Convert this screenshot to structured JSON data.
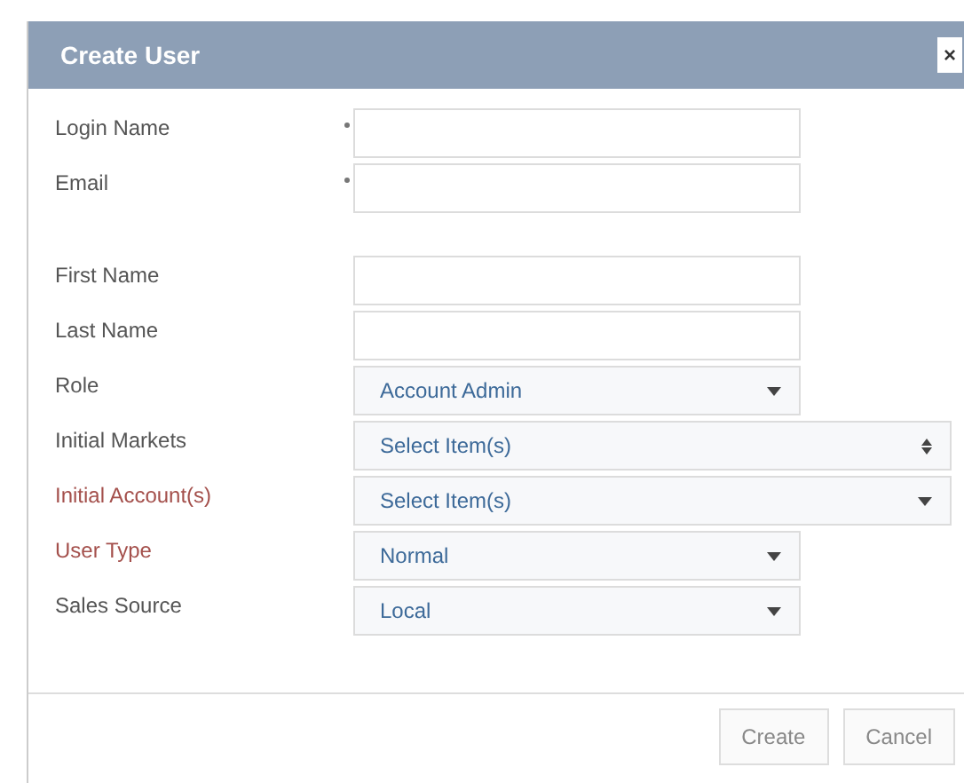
{
  "dialog": {
    "title": "Create User",
    "close": "×"
  },
  "sections": [
    [
      {
        "label": "Login Name",
        "kind": "text",
        "required": true,
        "error": false
      },
      {
        "label": "Email",
        "kind": "text",
        "required": true,
        "error": false
      }
    ],
    [
      {
        "label": "First Name",
        "kind": "text",
        "required": false,
        "error": false
      },
      {
        "label": "Last Name",
        "kind": "text",
        "required": false,
        "error": false
      },
      {
        "label": "Role",
        "kind": "select",
        "value": "Account Admin",
        "required": false,
        "error": false
      },
      {
        "label": "Initial Markets",
        "kind": "multiselect",
        "value": "Select Item(s)",
        "required": false,
        "error": false
      },
      {
        "label": "Initial Account(s)",
        "kind": "lookup",
        "value": "Select Item(s)",
        "required": false,
        "error": true
      },
      {
        "label": "User Type",
        "kind": "select",
        "value": "Normal",
        "required": false,
        "error": true
      },
      {
        "label": "Sales Source",
        "kind": "select",
        "value": "Local",
        "required": false,
        "error": false
      }
    ]
  ],
  "buttons": [
    "Create",
    "Cancel"
  ]
}
